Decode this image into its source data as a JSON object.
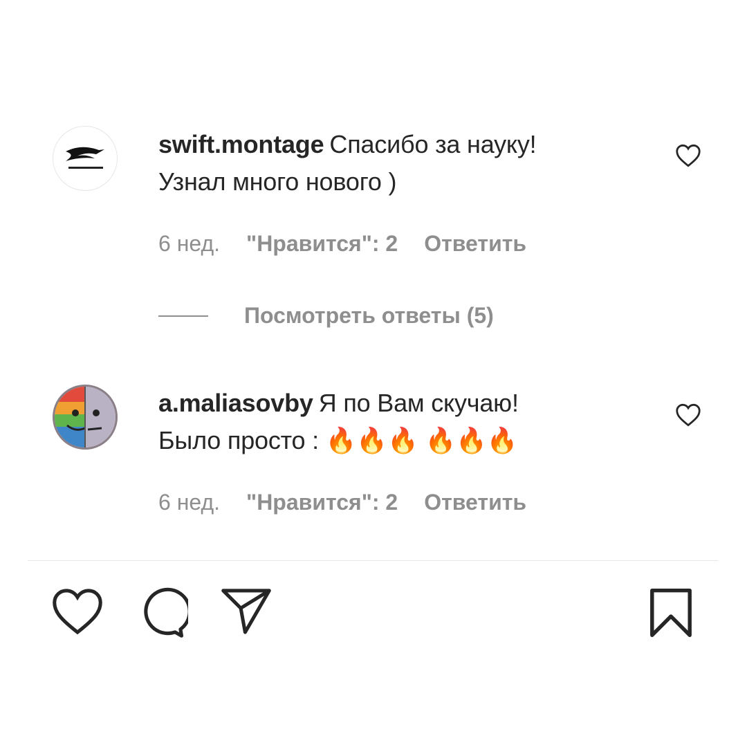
{
  "comments": [
    {
      "username": "swift.montage",
      "text": "Спасибо за науку!\nУзнал много нового )",
      "time": "6 нед.",
      "likes": "\"Нравится\": 2",
      "reply": "Ответить",
      "avatar_icon": "swift-bird-logo-icon",
      "like_icon": "heart-outline-icon"
    },
    {
      "username": "a.maliasovby",
      "text": "Я по Вам скучаю!\nБыло просто : 🔥🔥🔥  🔥🔥🔥",
      "time": "6 нед.",
      "likes": "\"Нравится\": 2",
      "reply": "Ответить",
      "avatar_icon": "split-face-avatar-icon",
      "like_icon": "heart-outline-icon"
    }
  ],
  "view_replies": "Посмотреть ответы (5)",
  "actions": [
    "heart-icon",
    "comment-icon",
    "share-icon",
    "bookmark-icon"
  ],
  "colors": {
    "text": "#262626",
    "secondary": "#8e8e8e",
    "divider": "#e6e6e6",
    "background": "#ffffff"
  }
}
